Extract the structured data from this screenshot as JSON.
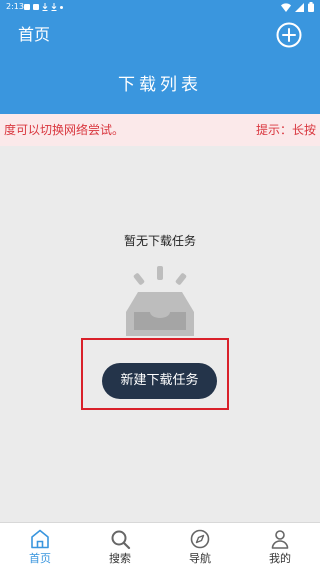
{
  "status_bar": {
    "time": "2:13"
  },
  "header": {
    "home_label": "首页",
    "title": "下载列表",
    "add_icon": "plus-circle-icon"
  },
  "notice": {
    "text": "度可以切换网络尝试。",
    "hint": "提示：长按"
  },
  "empty_state": {
    "message": "暂无下载任务",
    "icon": "empty-inbox-icon",
    "button_label": "新建下载任务"
  },
  "bottom_nav": {
    "items": [
      {
        "label": "首页",
        "icon": "home-icon",
        "active": true
      },
      {
        "label": "搜索",
        "icon": "search-icon",
        "active": false
      },
      {
        "label": "导航",
        "icon": "compass-icon",
        "active": false
      },
      {
        "label": "我的",
        "icon": "user-icon",
        "active": false
      }
    ]
  },
  "colors": {
    "accent": "#3a96de",
    "button": "#24344a",
    "notice_text": "#d9363e",
    "highlight": "#d9202a"
  }
}
